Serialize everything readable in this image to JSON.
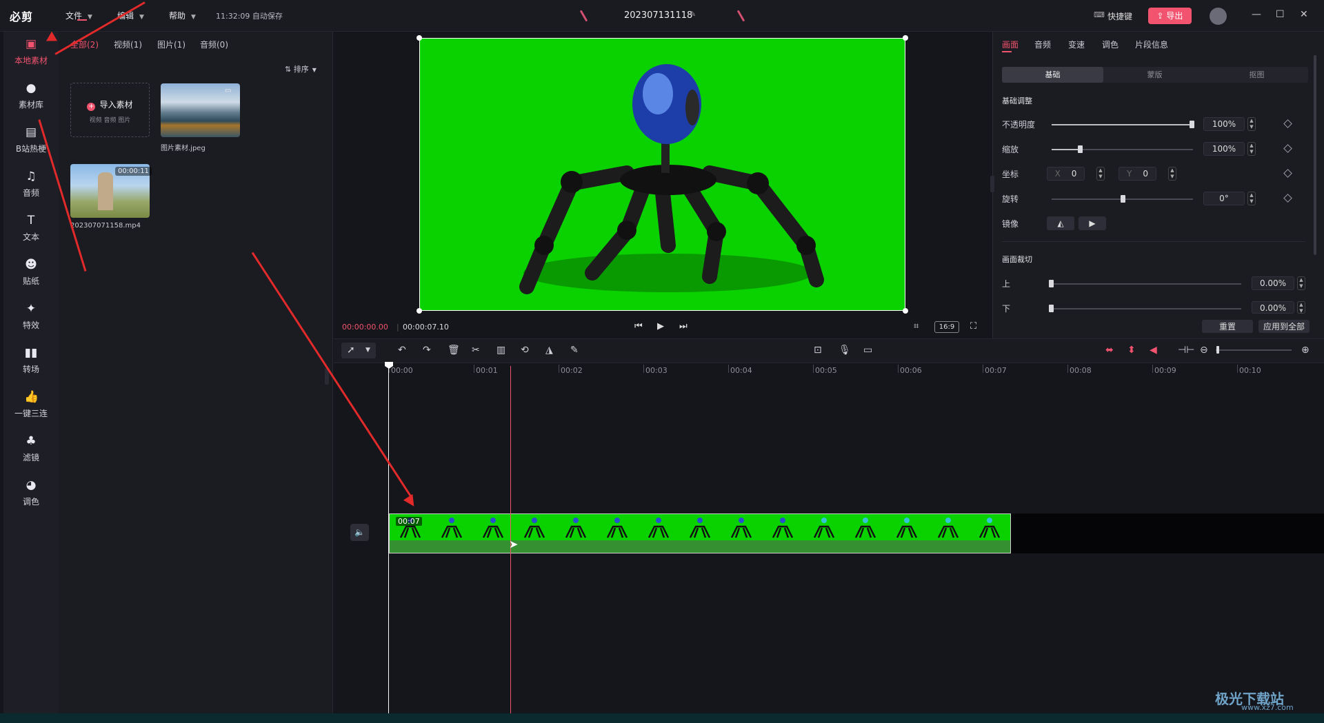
{
  "app": {
    "logo": "必剪",
    "menus": [
      "文件",
      "编辑",
      "帮助"
    ],
    "autosave": "11:32:09 自动保存",
    "project_title": "202307131118",
    "shortcut": "快捷键",
    "export": "导出"
  },
  "sidenav": [
    "本地素材",
    "素材库",
    "B站热梗",
    "音频",
    "文本",
    "贴纸",
    "特效",
    "转场",
    "一键三连",
    "滤镜",
    "调色"
  ],
  "media": {
    "tabs": [
      "全部(2)",
      "视频(1)",
      "图片(1)",
      "音频(0)"
    ],
    "sort": "排序",
    "import_label": "导入素材",
    "import_hint": "视频  音频  图片",
    "items": [
      {
        "name": "图片素材.jpeg"
      },
      {
        "name": "202307071158.mp4",
        "duration": "00:00:11"
      }
    ]
  },
  "preview": {
    "current_time": "00:00:00.00",
    "total_time": "00:00:07.10",
    "ratio": "16:9"
  },
  "props": {
    "tabs": [
      "画面",
      "音频",
      "变速",
      "调色",
      "片段信息"
    ],
    "segments": [
      "基础",
      "蒙版",
      "抠图"
    ],
    "section_basic": "基础调整",
    "opacity_label": "不透明度",
    "opacity": "100%",
    "scale_label": "缩放",
    "scale": "100%",
    "position_label": "坐标",
    "x_label": "X",
    "x": "0",
    "y_label": "Y",
    "y": "0",
    "rotate_label": "旋转",
    "rotate": "0°",
    "mirror_label": "镜像",
    "section_crop": "画面裁切",
    "crop_top_label": "上",
    "crop_top": "0.00%",
    "crop_bottom_label": "下",
    "crop_bottom": "0.00%",
    "reset": "重置",
    "apply_all": "应用到全部"
  },
  "timeline": {
    "ruler": [
      "00:00",
      "00:01",
      "00:02",
      "00:03",
      "00:04",
      "00:05",
      "00:06",
      "00:07",
      "00:08",
      "00:09",
      "00:10"
    ],
    "clip_duration": "00:07"
  },
  "watermark": {
    "name": "极光下载站",
    "url": "www.xz7.com"
  },
  "colors": {
    "accent": "#f2536e",
    "green_screen": "#0ad200"
  }
}
